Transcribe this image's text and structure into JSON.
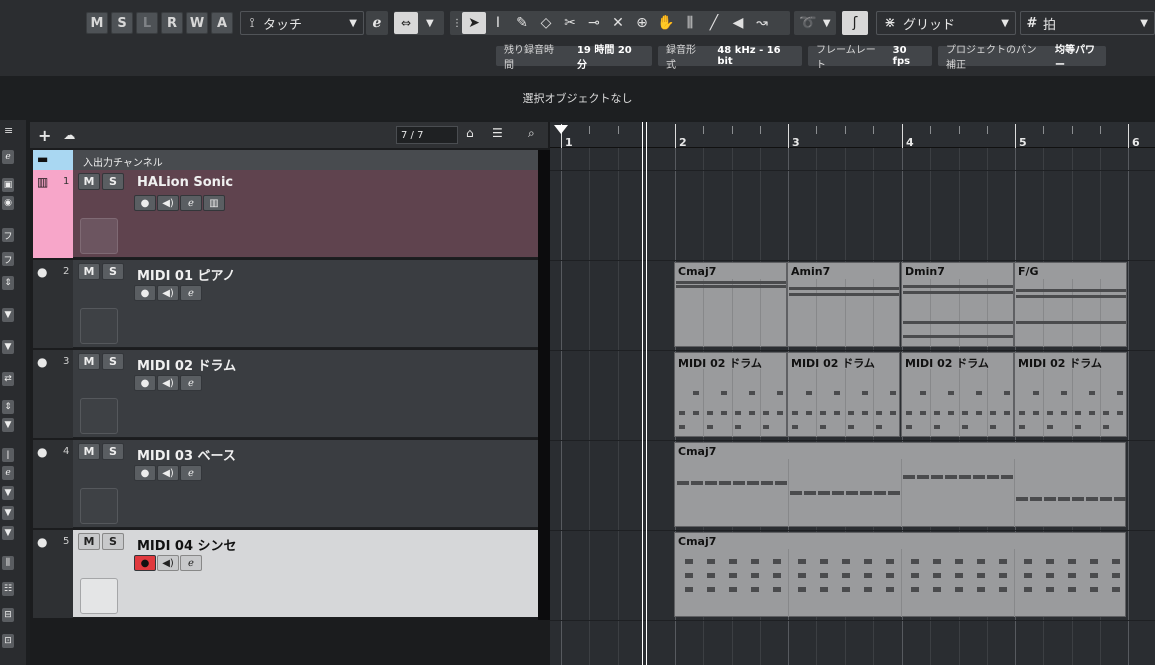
{
  "toolbar": {
    "mute_all": "M",
    "solo_all": "S",
    "listen": "L",
    "read": "R",
    "write": "W",
    "automation_a": "A",
    "automation_mode": "タッチ",
    "snap_type": "グリッド",
    "quantize": "拍"
  },
  "status": {
    "record_time_label": "残り録音時間",
    "record_time_value": "19 時間 20 分",
    "record_format_label": "録音形式",
    "record_format_value": "48 kHz - 16 bit",
    "frame_rate_label": "フレームレート",
    "frame_rate_value": "30 fps",
    "pan_law_label": "プロジェクトのパン補正",
    "pan_law_value": "均等パワー"
  },
  "info_line": "選択オブジェクトなし",
  "tracklist": {
    "count": "7 / 7",
    "io_channel_label": "入出力チャンネル"
  },
  "tracks": [
    {
      "num": "1",
      "name": "HALion Sonic",
      "mute": "M",
      "solo": "S"
    },
    {
      "num": "2",
      "name": "MIDI 01 ピアノ",
      "mute": "M",
      "solo": "S"
    },
    {
      "num": "3",
      "name": "MIDI 02 ドラム",
      "mute": "M",
      "solo": "S"
    },
    {
      "num": "4",
      "name": "MIDI 03 ベース",
      "mute": "M",
      "solo": "S"
    },
    {
      "num": "5",
      "name": "MIDI 04 シンセ",
      "mute": "M",
      "solo": "S"
    }
  ],
  "ruler": {
    "bars": [
      "1",
      "2",
      "3",
      "4",
      "5",
      "6"
    ]
  },
  "parts": {
    "piano": [
      "Cmaj7",
      "Amin7",
      "Dmin7",
      "F/G"
    ],
    "drums": [
      "MIDI 02 ドラム",
      "MIDI 02 ドラム",
      "MIDI 02 ドラム",
      "MIDI 02 ドラム"
    ],
    "bass": "Cmaj7",
    "synth": "Cmaj7"
  },
  "colors": {
    "record": "#e0393e",
    "track1": "#f7a6c9",
    "selected_track": "#d6d7d9"
  }
}
